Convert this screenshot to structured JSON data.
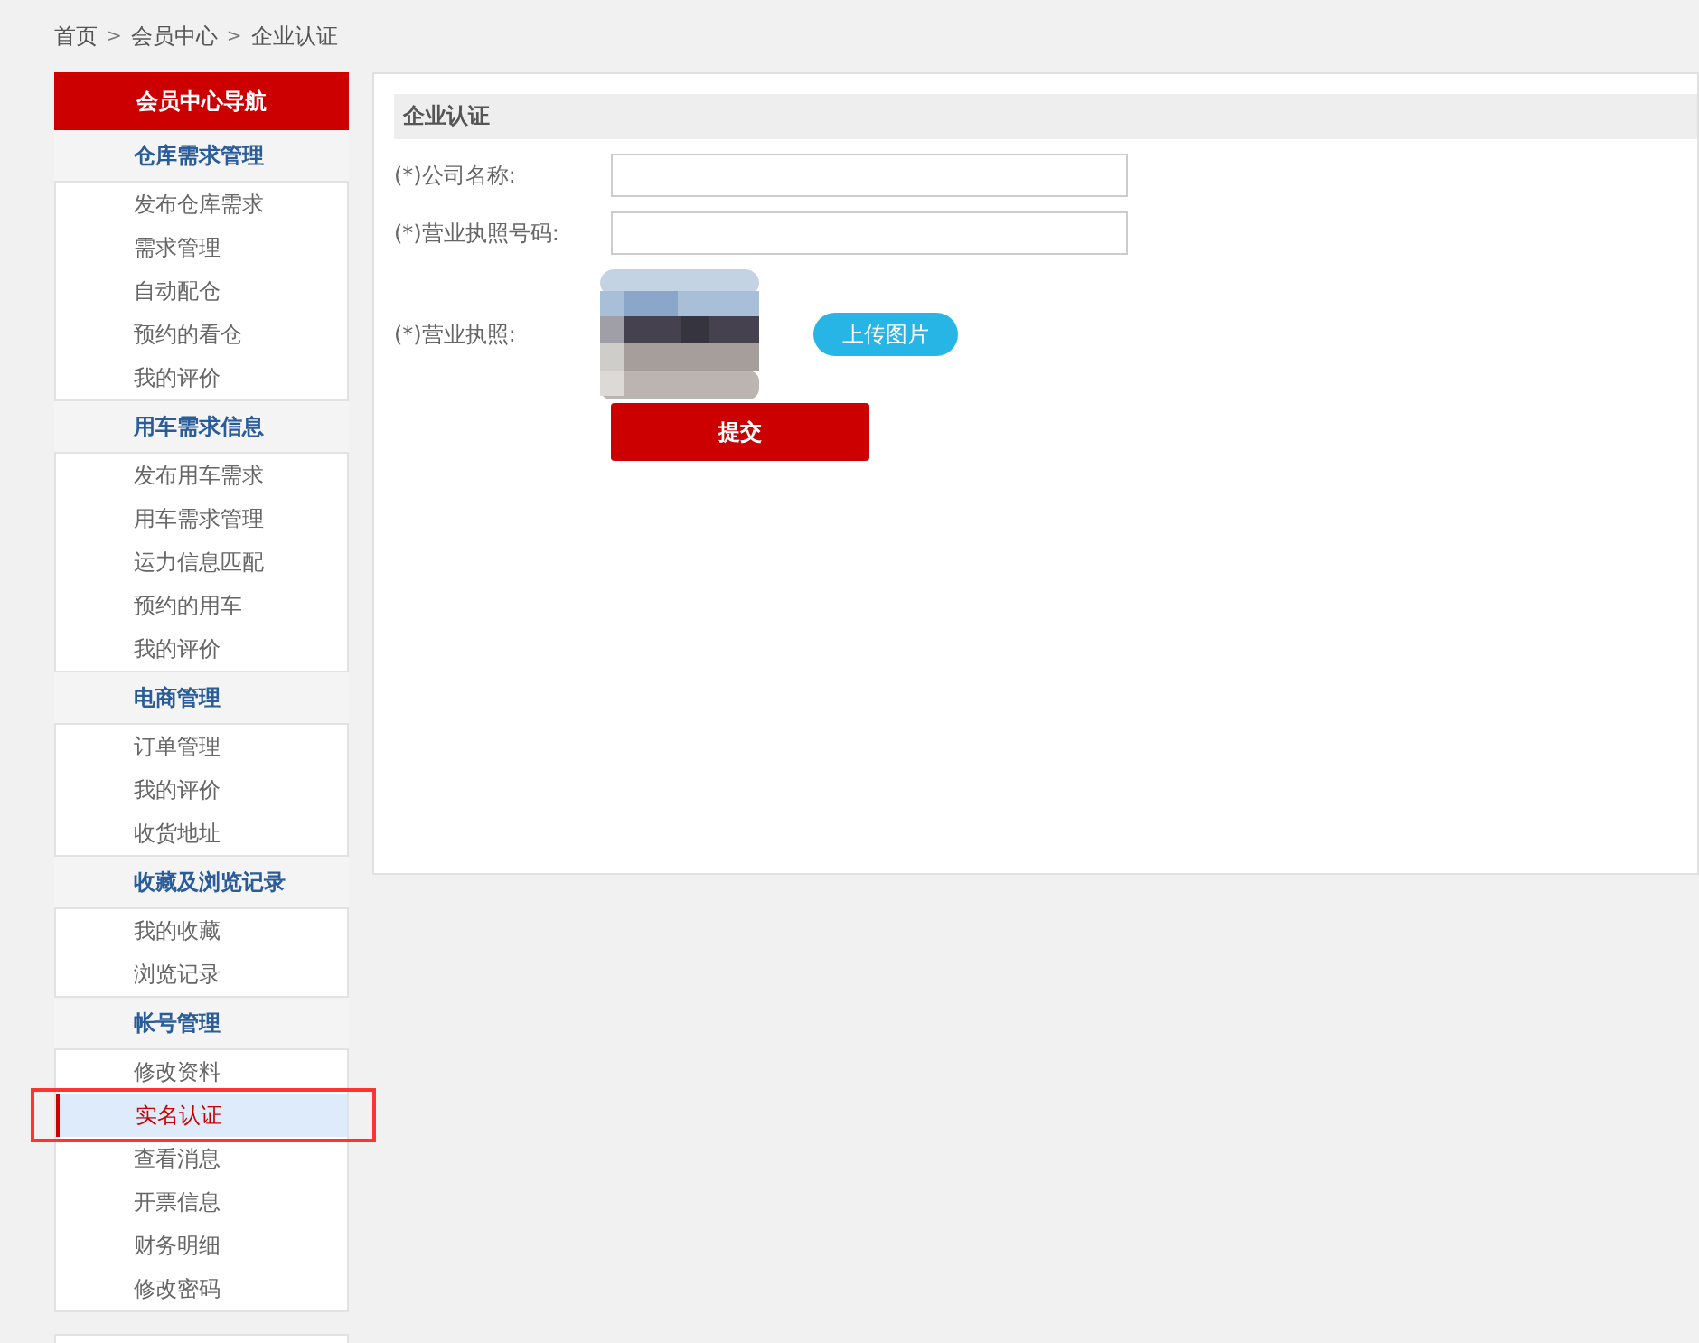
{
  "breadcrumb": [
    "首页",
    "会员中心",
    "企业认证"
  ],
  "breadcrumb_separator": ">",
  "sidebar": {
    "title": "会员中心导航",
    "groups": [
      {
        "label": "仓库需求管理",
        "items": [
          {
            "label": "发布仓库需求",
            "selected": false,
            "highlighted": false
          },
          {
            "label": "需求管理",
            "selected": false,
            "highlighted": false
          },
          {
            "label": "自动配仓",
            "selected": false,
            "highlighted": false
          },
          {
            "label": "预约的看仓",
            "selected": false,
            "highlighted": false
          },
          {
            "label": "我的评价",
            "selected": false,
            "highlighted": false
          }
        ]
      },
      {
        "label": "用车需求信息",
        "items": [
          {
            "label": "发布用车需求",
            "selected": false,
            "highlighted": false
          },
          {
            "label": "用车需求管理",
            "selected": false,
            "highlighted": false
          },
          {
            "label": "运力信息匹配",
            "selected": false,
            "highlighted": false
          },
          {
            "label": "预约的用车",
            "selected": false,
            "highlighted": false
          },
          {
            "label": "我的评价",
            "selected": false,
            "highlighted": false
          }
        ]
      },
      {
        "label": "电商管理",
        "items": [
          {
            "label": "订单管理",
            "selected": false,
            "highlighted": false
          },
          {
            "label": "我的评价",
            "selected": false,
            "highlighted": false
          },
          {
            "label": "收货地址",
            "selected": false,
            "highlighted": false
          }
        ]
      },
      {
        "label": "收藏及浏览记录",
        "items": [
          {
            "label": "我的收藏",
            "selected": false,
            "highlighted": false
          },
          {
            "label": "浏览记录",
            "selected": false,
            "highlighted": false
          }
        ]
      },
      {
        "label": "帐号管理",
        "items": [
          {
            "label": "修改资料",
            "selected": false,
            "highlighted": false
          },
          {
            "label": "实名认证",
            "selected": true,
            "highlighted": true
          },
          {
            "label": "查看消息",
            "selected": false,
            "highlighted": false
          },
          {
            "label": "开票信息",
            "selected": false,
            "highlighted": false
          },
          {
            "label": "财务明细",
            "selected": false,
            "highlighted": false
          },
          {
            "label": "修改密码",
            "selected": false,
            "highlighted": false
          }
        ]
      }
    ]
  },
  "form": {
    "title": "企业认证",
    "fields": [
      {
        "kind": "text",
        "label": "(*)公司名称:"
      },
      {
        "kind": "text",
        "label": "(*)营业执照号码:"
      },
      {
        "label": "(*)营业执照:",
        "upload_button": "上传图片"
      }
    ],
    "submit": "提交"
  }
}
